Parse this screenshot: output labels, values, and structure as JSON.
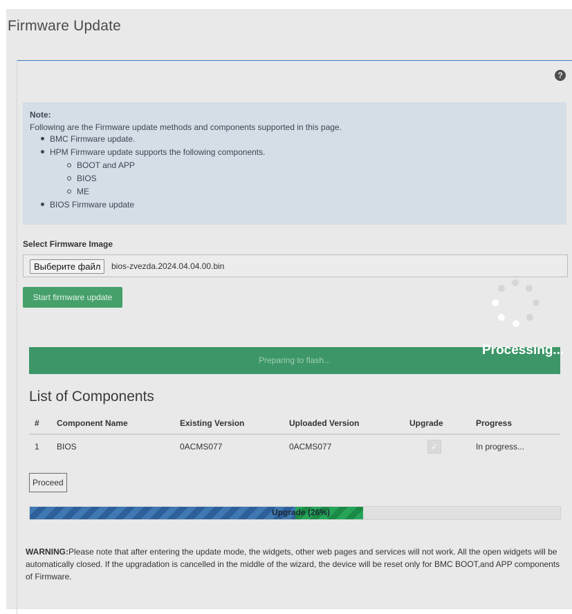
{
  "page": {
    "title": "Firmware Update"
  },
  "note": {
    "title": "Note:",
    "intro": "Following are the Firmware update methods and components supported in this page.",
    "items": [
      "BMC Firmware update.",
      "HPM Firmware update supports the following components.",
      "BIOS Firmware update"
    ],
    "subitems": [
      "BOOT and APP",
      "BIOS",
      "ME"
    ]
  },
  "file_select": {
    "label": "Select Firmware Image",
    "button_label": "Выберите файл",
    "file_name": "bios-zvezda.2024.04.04.00.bin"
  },
  "start_button": "Start firmware update",
  "processing_text": "Processing...",
  "prep_bar_text": "Preparing to flash...",
  "components": {
    "title": "List of Components",
    "headers": [
      "#",
      "Component Name",
      "Existing Version",
      "Uploaded Version",
      "Upgrade",
      "Progress"
    ],
    "rows": [
      {
        "num": "1",
        "name": "BIOS",
        "existing": "0ACMS077",
        "uploaded": "0ACMS077",
        "upgrade_checked": true,
        "progress": "In progress..."
      }
    ]
  },
  "proceed_button": "Proceed",
  "upgrade_progress": {
    "label": "Upgrade (26%)",
    "percent": 26
  },
  "warning": {
    "prefix": "WARNING:",
    "text": "Please note that after entering the update mode, the widgets, other web pages and services will not work. All the open widgets will be automatically closed. If the upgradation is cancelled in the middle of the wizard, the device will be reset only for BMC BOOT,and APP components of Firmware."
  },
  "colors": {
    "accent_green": "#45a06a",
    "panel_border": "#3b7dbb",
    "note_bg": "#d5dde6"
  },
  "icons": {
    "help": "question-circle-icon",
    "checkbox": "check-icon"
  }
}
